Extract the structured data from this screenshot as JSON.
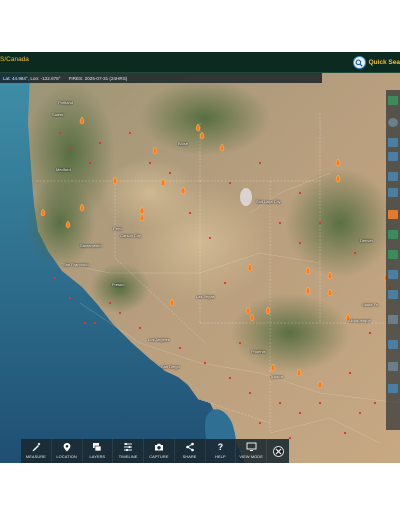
{
  "header": {
    "region_link": "S/Canada",
    "search_label": "Quick Sea"
  },
  "info": {
    "coords": "Lat: 44.984°, Lon: -132.678°",
    "fires": "FIRES: 2025-07-31 (24HRS)"
  },
  "cities": [
    "Portland",
    "Salem",
    "Medford",
    "Boise",
    "Salt Lake City",
    "Sacramento",
    "San Francisco",
    "Fresno",
    "Las Vegas",
    "Los Angeles",
    "San Diego",
    "Phoenix",
    "Tucson",
    "Santa Fe",
    "Albuquerque",
    "Denver",
    "Reno",
    "Carson City"
  ],
  "toolbar": {
    "measure": "MEASURE",
    "location": "LOCATION",
    "layers": "LAYERS",
    "timeline": "TIMELINE",
    "capture": "CAPTURE",
    "share": "SHARE",
    "help": "HELP",
    "view_mode": "VIEW MODE"
  },
  "colors": {
    "header_bg": "#0c2a1f",
    "accent": "#f2c230",
    "fire": "#ff7a1a",
    "hotspot": "#e5322d"
  },
  "icons": {
    "search": "magnifier-icon",
    "close": "close-icon"
  }
}
